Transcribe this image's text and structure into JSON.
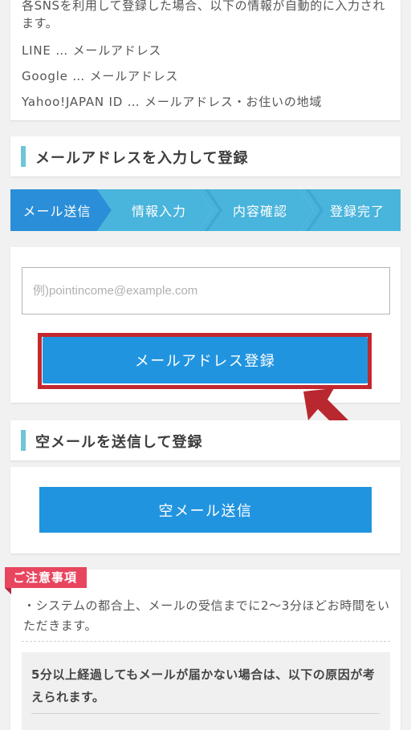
{
  "sns": {
    "intro": "各SNSを利用して登録した場合、以下の情報が自動的に入力されます。",
    "items": [
      "LINE … メールアドレス",
      "Google … メールアドレス",
      "Yahoo!JAPAN ID … メールアドレス・お住いの地域"
    ]
  },
  "email_section": {
    "title": "メールアドレスを入力して登録",
    "steps": [
      "メール送信",
      "情報入力",
      "内容確認",
      "登録完了"
    ],
    "current_step": 1,
    "email_placeholder": "例)pointincome@example.com",
    "email_value": "",
    "submit_label": "メールアドレス登録"
  },
  "empty_mail_section": {
    "title": "空メールを送信して登録",
    "button_label": "空メール送信"
  },
  "notice": {
    "tag": "ご注意事項",
    "text": "・システムの都合上、メールの受信までに2〜3分ほどお時間をいただきます。",
    "sub_text": "5分以上経過してもメールが届かない場合は、以下の原因が考えられます。"
  },
  "colors": {
    "primary_button": "#2194e0",
    "highlight_border": "#c3282f",
    "arrow": "#b9282f",
    "step_active": "#2b8ed8",
    "step_inactive": "#49b4dc",
    "heading_bar": "#6ec6d6",
    "notice_tag": "#e8455f"
  }
}
